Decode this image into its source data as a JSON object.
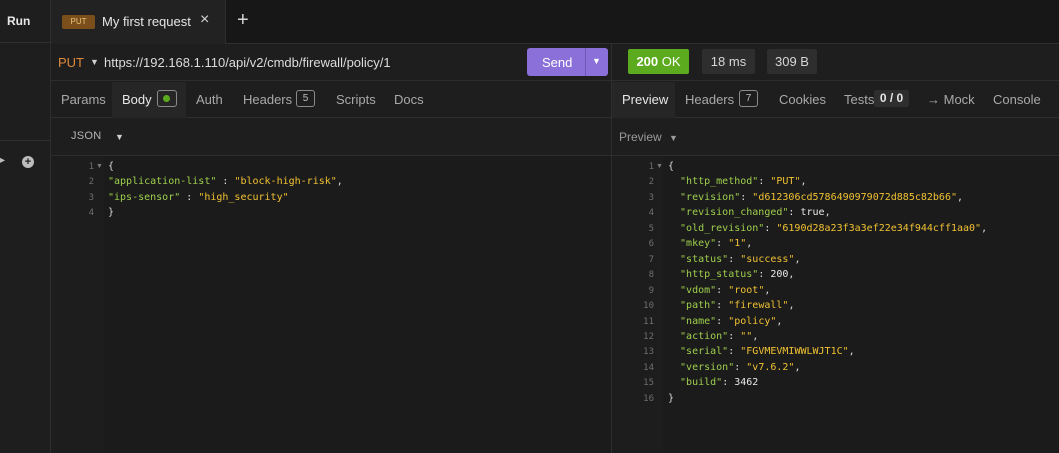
{
  "sidebar": {
    "run_label": "Run"
  },
  "tab": {
    "method": "PUT",
    "title": "My first request",
    "close_icon": "×",
    "new_tab_icon": "+"
  },
  "request": {
    "method": "PUT",
    "url": "https://192.168.1.110/api/v2/cmdb/firewall/policy/1",
    "send_label": "Send",
    "tabs": {
      "params": "Params",
      "body": "Body",
      "auth": "Auth",
      "headers": "Headers",
      "headers_count": "5",
      "scripts": "Scripts",
      "docs": "Docs"
    },
    "body_format": "JSON",
    "body_lines": [
      [
        {
          "t": "{",
          "c": "p"
        }
      ],
      [
        {
          "t": "\"application-list\"",
          "c": "k"
        },
        {
          "t": " : ",
          "c": "p"
        },
        {
          "t": "\"block-high-risk\"",
          "c": "s"
        },
        {
          "t": ",",
          "c": "p"
        }
      ],
      [
        {
          "t": "\"ips-sensor\"",
          "c": "k"
        },
        {
          "t": " : ",
          "c": "p"
        },
        {
          "t": "\"high_security\"",
          "c": "s"
        }
      ],
      [
        {
          "t": "}",
          "c": "p"
        }
      ]
    ]
  },
  "response": {
    "status_code": "200",
    "status_text": "OK",
    "time": "18 ms",
    "size": "309 B",
    "tabs": {
      "preview": "Preview",
      "headers": "Headers",
      "headers_count": "7",
      "cookies": "Cookies",
      "tests": "Tests",
      "tests_count": "0 / 0",
      "mock": "→ Mock",
      "console": "Console"
    },
    "preview_mode": "Preview",
    "body_lines": [
      [
        {
          "t": "{",
          "c": "p"
        }
      ],
      [
        {
          "t": "  \"http_method\"",
          "c": "k"
        },
        {
          "t": ": ",
          "c": "p"
        },
        {
          "t": "\"PUT\"",
          "c": "s"
        },
        {
          "t": ",",
          "c": "p"
        }
      ],
      [
        {
          "t": "  \"revision\"",
          "c": "k"
        },
        {
          "t": ": ",
          "c": "p"
        },
        {
          "t": "\"d612306cd5786490979072d885c82b66\"",
          "c": "s"
        },
        {
          "t": ",",
          "c": "p"
        }
      ],
      [
        {
          "t": "  \"revision_changed\"",
          "c": "k"
        },
        {
          "t": ": ",
          "c": "p"
        },
        {
          "t": "true",
          "c": "n"
        },
        {
          "t": ",",
          "c": "p"
        }
      ],
      [
        {
          "t": "  \"old_revision\"",
          "c": "k"
        },
        {
          "t": ": ",
          "c": "p"
        },
        {
          "t": "\"6190d28a23f3a3ef22e34f944cff1aa0\"",
          "c": "s"
        },
        {
          "t": ",",
          "c": "p"
        }
      ],
      [
        {
          "t": "  \"mkey\"",
          "c": "k"
        },
        {
          "t": ": ",
          "c": "p"
        },
        {
          "t": "\"1\"",
          "c": "s"
        },
        {
          "t": ",",
          "c": "p"
        }
      ],
      [
        {
          "t": "  \"status\"",
          "c": "k"
        },
        {
          "t": ": ",
          "c": "p"
        },
        {
          "t": "\"success\"",
          "c": "s"
        },
        {
          "t": ",",
          "c": "p"
        }
      ],
      [
        {
          "t": "  \"http_status\"",
          "c": "k"
        },
        {
          "t": ": ",
          "c": "p"
        },
        {
          "t": "200",
          "c": "n"
        },
        {
          "t": ",",
          "c": "p"
        }
      ],
      [
        {
          "t": "  \"vdom\"",
          "c": "k"
        },
        {
          "t": ": ",
          "c": "p"
        },
        {
          "t": "\"root\"",
          "c": "s"
        },
        {
          "t": ",",
          "c": "p"
        }
      ],
      [
        {
          "t": "  \"path\"",
          "c": "k"
        },
        {
          "t": ": ",
          "c": "p"
        },
        {
          "t": "\"firewall\"",
          "c": "s"
        },
        {
          "t": ",",
          "c": "p"
        }
      ],
      [
        {
          "t": "  \"name\"",
          "c": "k"
        },
        {
          "t": ": ",
          "c": "p"
        },
        {
          "t": "\"policy\"",
          "c": "s"
        },
        {
          "t": ",",
          "c": "p"
        }
      ],
      [
        {
          "t": "  \"action\"",
          "c": "k"
        },
        {
          "t": ": ",
          "c": "p"
        },
        {
          "t": "\"\"",
          "c": "s"
        },
        {
          "t": ",",
          "c": "p"
        }
      ],
      [
        {
          "t": "  \"serial\"",
          "c": "k"
        },
        {
          "t": ": ",
          "c": "p"
        },
        {
          "t": "\"FGVMEVMIWWLWJT1C\"",
          "c": "s"
        },
        {
          "t": ",",
          "c": "p"
        }
      ],
      [
        {
          "t": "  \"version\"",
          "c": "k"
        },
        {
          "t": ": ",
          "c": "p"
        },
        {
          "t": "\"v7.6.2\"",
          "c": "s"
        },
        {
          "t": ",",
          "c": "p"
        }
      ],
      [
        {
          "t": "  \"build\"",
          "c": "k"
        },
        {
          "t": ": ",
          "c": "p"
        },
        {
          "t": "3462",
          "c": "n"
        }
      ],
      [
        {
          "t": "}",
          "c": "p"
        }
      ]
    ]
  },
  "colors": {
    "accent_send": "#8a70d8",
    "status_ok": "#5cab1e",
    "method_put": "#e0893b",
    "json_key": "#9fcf4d",
    "json_string": "#f1c232"
  }
}
